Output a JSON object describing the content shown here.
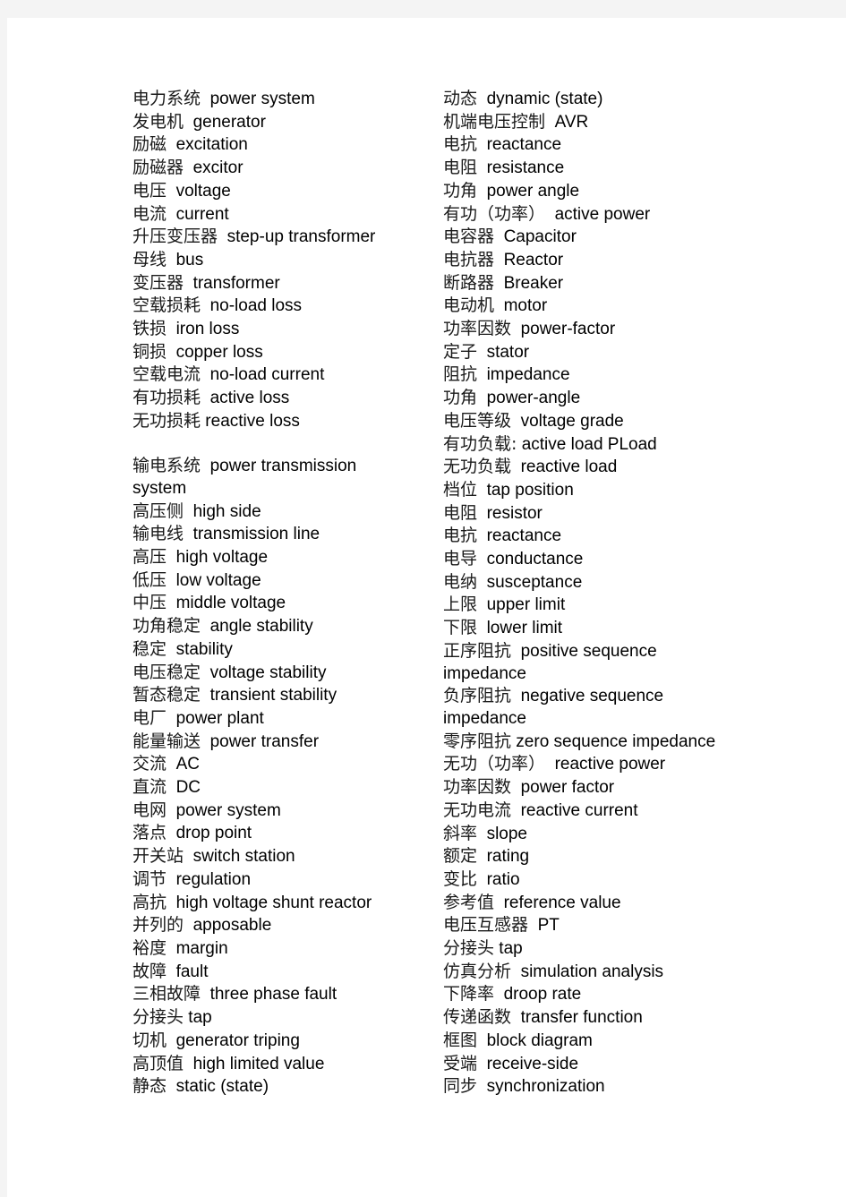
{
  "document": {
    "type": "bilingual-glossary",
    "columns": [
      {
        "id": "left-column",
        "entries": [
          {
            "zh": "电力系统",
            "en": "power system"
          },
          {
            "zh": "发电机",
            "en": "generator"
          },
          {
            "zh": "励磁",
            "en": "excitation"
          },
          {
            "zh": "励磁器",
            "en": "excitor"
          },
          {
            "zh": "电压",
            "en": "voltage"
          },
          {
            "zh": "电流",
            "en": "current"
          },
          {
            "zh": "升压变压器",
            "en": "step-up transformer"
          },
          {
            "zh": "母线",
            "en": "bus"
          },
          {
            "zh": "变压器",
            "en": "transformer"
          },
          {
            "zh": "空载损耗",
            "en": "no-load loss"
          },
          {
            "zh": "铁损",
            "en": "iron loss"
          },
          {
            "zh": "铜损",
            "en": "copper loss"
          },
          {
            "zh": "空载电流",
            "en": "no-load current"
          },
          {
            "zh": "有功损耗",
            "en": "active loss"
          },
          {
            "zh": "无功损耗",
            "en": "reactive loss",
            "tight": true
          },
          {
            "spacer": true
          },
          {
            "zh": "输电系统",
            "en": "power transmission"
          },
          {
            "continuation": "system"
          },
          {
            "zh": "高压侧",
            "en": "high side"
          },
          {
            "zh": "输电线",
            "en": "transmission line"
          },
          {
            "zh": "高压",
            "en": "high voltage"
          },
          {
            "zh": "低压",
            "en": "low voltage"
          },
          {
            "zh": "中压",
            "en": "middle voltage"
          },
          {
            "zh": "功角稳定",
            "en": "angle stability"
          },
          {
            "zh": "稳定",
            "en": "stability"
          },
          {
            "zh": "电压稳定",
            "en": "voltage stability"
          },
          {
            "zh": "暂态稳定",
            "en": "transient stability"
          },
          {
            "zh": "电厂",
            "en": "power plant"
          },
          {
            "zh": "能量输送",
            "en": "power transfer"
          },
          {
            "zh": "交流",
            "en": "AC"
          },
          {
            "zh": "直流",
            "en": "DC"
          },
          {
            "zh": "电网",
            "en": "power system"
          },
          {
            "zh": "落点",
            "en": "drop point"
          },
          {
            "zh": "开关站",
            "en": "switch station"
          },
          {
            "zh": "调节",
            "en": "regulation"
          },
          {
            "zh": "高抗",
            "en": "high voltage shunt reactor"
          },
          {
            "zh": "并列的",
            "en": "apposable"
          },
          {
            "zh": "裕度",
            "en": "margin"
          },
          {
            "zh": "故障",
            "en": "fault"
          },
          {
            "zh": "三相故障",
            "en": "three phase fault"
          },
          {
            "zh": "分接头",
            "en": "tap",
            "tight": true
          },
          {
            "zh": "切机",
            "en": "generator triping"
          },
          {
            "zh": "高顶值",
            "en": "high limited value"
          },
          {
            "zh": "静态",
            "en": "static (state)"
          }
        ]
      },
      {
        "id": "right-column",
        "entries": [
          {
            "zh": "动态",
            "en": "dynamic (state)"
          },
          {
            "zh": "机端电压控制",
            "en": "AVR"
          },
          {
            "zh": "电抗",
            "en": "reactance"
          },
          {
            "zh": "电阻",
            "en": "resistance"
          },
          {
            "zh": "功角",
            "en": "power angle"
          },
          {
            "zh": "有功（功率）",
            "en": "active power"
          },
          {
            "zh": "电容器",
            "en": "Capacitor"
          },
          {
            "zh": "电抗器",
            "en": "Reactor"
          },
          {
            "zh": "断路器",
            "en": "Breaker"
          },
          {
            "zh": "电动机",
            "en": "motor"
          },
          {
            "zh": "功率因数",
            "en": "power-factor"
          },
          {
            "zh": "定子",
            "en": "stator"
          },
          {
            "zh": "阻抗",
            "en": "impedance"
          },
          {
            "zh": "功角",
            "en": "power-angle"
          },
          {
            "zh": "电压等级",
            "en": "voltage grade"
          },
          {
            "zh": "有功负载:",
            "en": "active load PLoad",
            "tight": true
          },
          {
            "zh": "无功负载",
            "en": "reactive load"
          },
          {
            "zh": "档位",
            "en": "tap position"
          },
          {
            "zh": "电阻",
            "en": "resistor"
          },
          {
            "zh": "电抗",
            "en": "reactance"
          },
          {
            "zh": "电导",
            "en": "conductance"
          },
          {
            "zh": "电纳",
            "en": "susceptance"
          },
          {
            "zh": "上限",
            "en": "upper limit"
          },
          {
            "zh": "下限",
            "en": "lower limit"
          },
          {
            "zh": "正序阻抗",
            "en": "positive sequence"
          },
          {
            "continuation": "impedance"
          },
          {
            "zh": "负序阻抗",
            "en": "negative sequence"
          },
          {
            "continuation": "impedance"
          },
          {
            "zh": "零序阻抗",
            "en": "zero sequence impedance",
            "tight": true
          },
          {
            "zh": "无功（功率）",
            "en": "reactive power"
          },
          {
            "zh": "功率因数",
            "en": "power factor"
          },
          {
            "zh": "无功电流",
            "en": "reactive current"
          },
          {
            "zh": "斜率",
            "en": "slope"
          },
          {
            "zh": "额定",
            "en": "rating"
          },
          {
            "zh": "变比",
            "en": "ratio"
          },
          {
            "zh": "参考值",
            "en": "reference value"
          },
          {
            "zh": "电压互感器",
            "en": "PT"
          },
          {
            "zh": "分接头",
            "en": "tap",
            "tight": true
          },
          {
            "zh": "仿真分析",
            "en": "simulation analysis"
          },
          {
            "zh": "下降率",
            "en": "droop rate"
          },
          {
            "zh": "传递函数",
            "en": "transfer function"
          },
          {
            "zh": "框图",
            "en": "block diagram"
          },
          {
            "zh": "受端",
            "en": "receive-side"
          },
          {
            "zh": "同步",
            "en": "synchronization"
          }
        ]
      }
    ]
  },
  "colors": {
    "page_background": "#f4f4f4",
    "sheet": "#ffffff",
    "text": "#000000",
    "chinese_text": "#1a1a1a"
  }
}
